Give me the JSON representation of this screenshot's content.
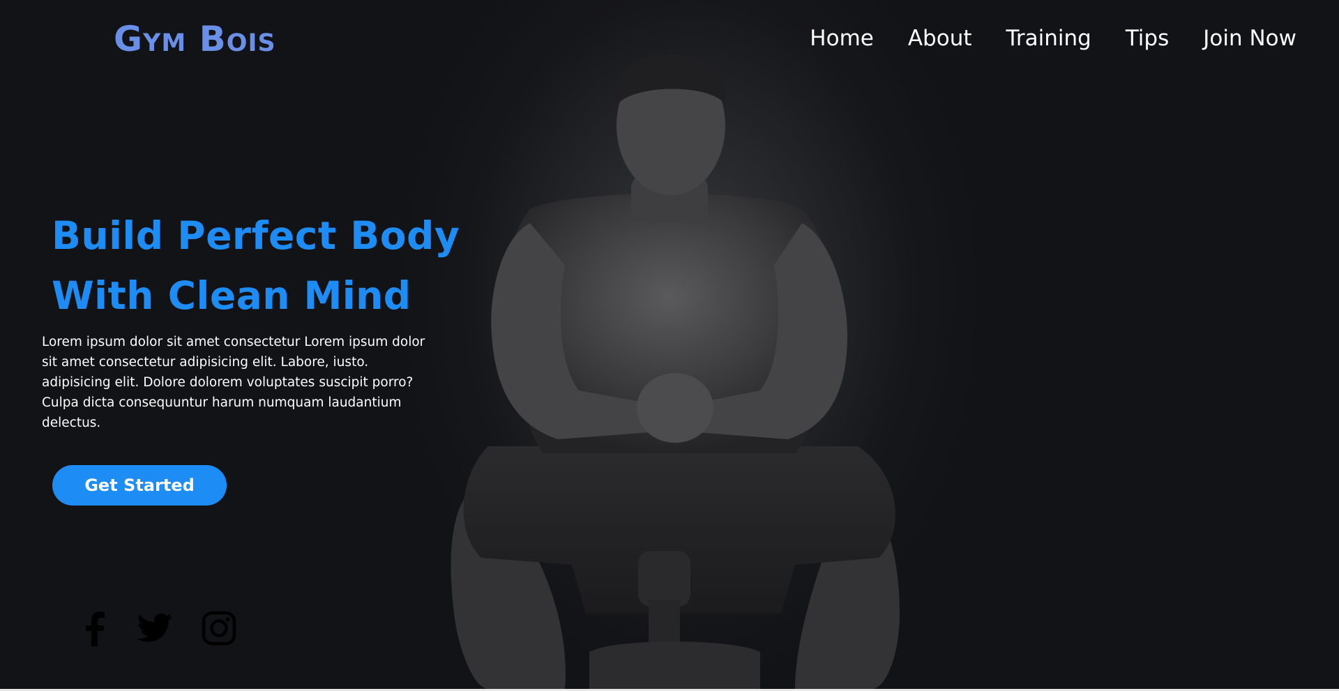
{
  "header": {
    "logo": "Gym Bois",
    "nav": [
      {
        "label": "Home"
      },
      {
        "label": "About"
      },
      {
        "label": "Training"
      },
      {
        "label": "Tips"
      },
      {
        "label": "Join Now"
      }
    ]
  },
  "hero": {
    "headline_line1": "Build Perfect Body",
    "headline_line2": "With Clean Mind",
    "description": "Lorem ipsum dolor sit amet consectetur Lorem ipsum dolor sit amet consectetur adipisicing elit. Labore, iusto. adipisicing elit. Dolore dolorem voluptates suscipit porro? Culpa dicta consequuntur harum numquam laudantium delectus.",
    "cta_label": "Get Started"
  },
  "socials": [
    {
      "icon": "facebook-icon"
    },
    {
      "icon": "twitter-icon"
    },
    {
      "icon": "instagram-icon"
    }
  ],
  "colors": {
    "background": "#121316",
    "accent": "#1e8cf5",
    "logo": "#6a8fe6",
    "text": "#ffffff"
  }
}
